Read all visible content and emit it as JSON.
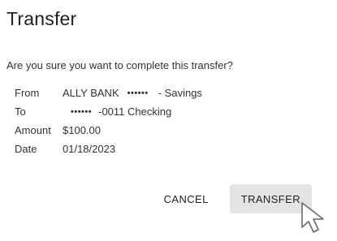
{
  "dialog": {
    "title": "Transfer",
    "question": "Are you sure you want to complete this transfer?",
    "details": {
      "from_label": "From",
      "from_bank": "ALLY BANK",
      "from_mask": "••••••",
      "from_account": "- Savings",
      "to_label": "To",
      "to_mask": "••••••",
      "to_account": "-0011 Checking",
      "amount_label": "Amount",
      "amount_value": "$100.00",
      "date_label": "Date",
      "date_value": "01/18/2023"
    },
    "actions": {
      "cancel_label": "CANCEL",
      "transfer_label": "TRANSFER"
    }
  },
  "colors": {
    "text": "#212121",
    "transfer_button_bg": "#e4e4e4"
  },
  "icons": {
    "cursor": "mouse-pointer-icon"
  }
}
